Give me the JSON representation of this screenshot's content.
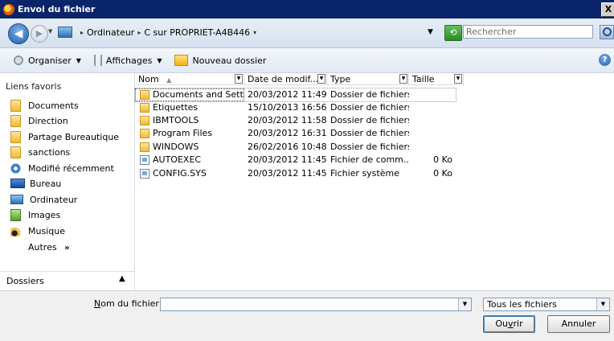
{
  "window": {
    "title": "Envoi du fichier",
    "close_label": "X"
  },
  "addressbar": {
    "crumbs": [
      "Ordinateur",
      "C sur PROPRIET-A4B446"
    ],
    "search_placeholder": "Rechercher"
  },
  "toolbar": {
    "organize_label": "Organiser",
    "views_label": "Affichages",
    "new_folder_label": "Nouveau dossier",
    "help_label": "?"
  },
  "navpane": {
    "favorites_header": "Liens favoris",
    "favorites": [
      {
        "label": "Documents",
        "icon": "folder-icon"
      },
      {
        "label": "Direction",
        "icon": "folder-icon"
      },
      {
        "label": "Partage Bureautique",
        "icon": "folder-icon"
      },
      {
        "label": "sanctions",
        "icon": "folder-icon"
      },
      {
        "label": "Modifié récemment",
        "icon": "recent-icon"
      },
      {
        "label": "Bureau",
        "icon": "desktop-icon"
      },
      {
        "label": "Ordinateur",
        "icon": "computer-icon"
      },
      {
        "label": "Images",
        "icon": "images-icon"
      },
      {
        "label": "Musique",
        "icon": "music-icon"
      }
    ],
    "more_label": "Autres",
    "more_chevron": "»",
    "folders_label": "Dossiers"
  },
  "filelist": {
    "columns": [
      "Nom",
      "Date de modif...",
      "Type",
      "Taille"
    ],
    "rows": [
      {
        "name": "Documents and Setti...",
        "date": "20/03/2012 11:49",
        "type": "Dossier de fichiers",
        "size": "",
        "icon": "folder-icon"
      },
      {
        "name": "Etiquettes",
        "date": "15/10/2013 16:56",
        "type": "Dossier de fichiers",
        "size": "",
        "icon": "folder-icon"
      },
      {
        "name": "IBMTOOLS",
        "date": "20/03/2012 11:58",
        "type": "Dossier de fichiers",
        "size": "",
        "icon": "folder-icon"
      },
      {
        "name": "Program Files",
        "date": "20/03/2012 16:31",
        "type": "Dossier de fichiers",
        "size": "",
        "icon": "folder-icon"
      },
      {
        "name": "WINDOWS",
        "date": "26/02/2016 10:48",
        "type": "Dossier de fichiers",
        "size": "",
        "icon": "folder-icon"
      },
      {
        "name": "AUTOEXEC",
        "date": "20/03/2012 11:45",
        "type": "Fichier de comm...",
        "size": "0 Ko",
        "icon": "file-icon"
      },
      {
        "name": "CONFIG.SYS",
        "date": "20/03/2012 11:45",
        "type": "Fichier système",
        "size": "0 Ko",
        "icon": "file-icon"
      }
    ]
  },
  "footer": {
    "filename_label_prefix": "N",
    "filename_label_rest": "om du fichier :",
    "filename_value": "",
    "filter_value": "Tous les fichiers",
    "open_label_prefix": "Ou",
    "open_label_underlined": "v",
    "open_label_suffix": "rir",
    "cancel_label": "Annuler"
  }
}
